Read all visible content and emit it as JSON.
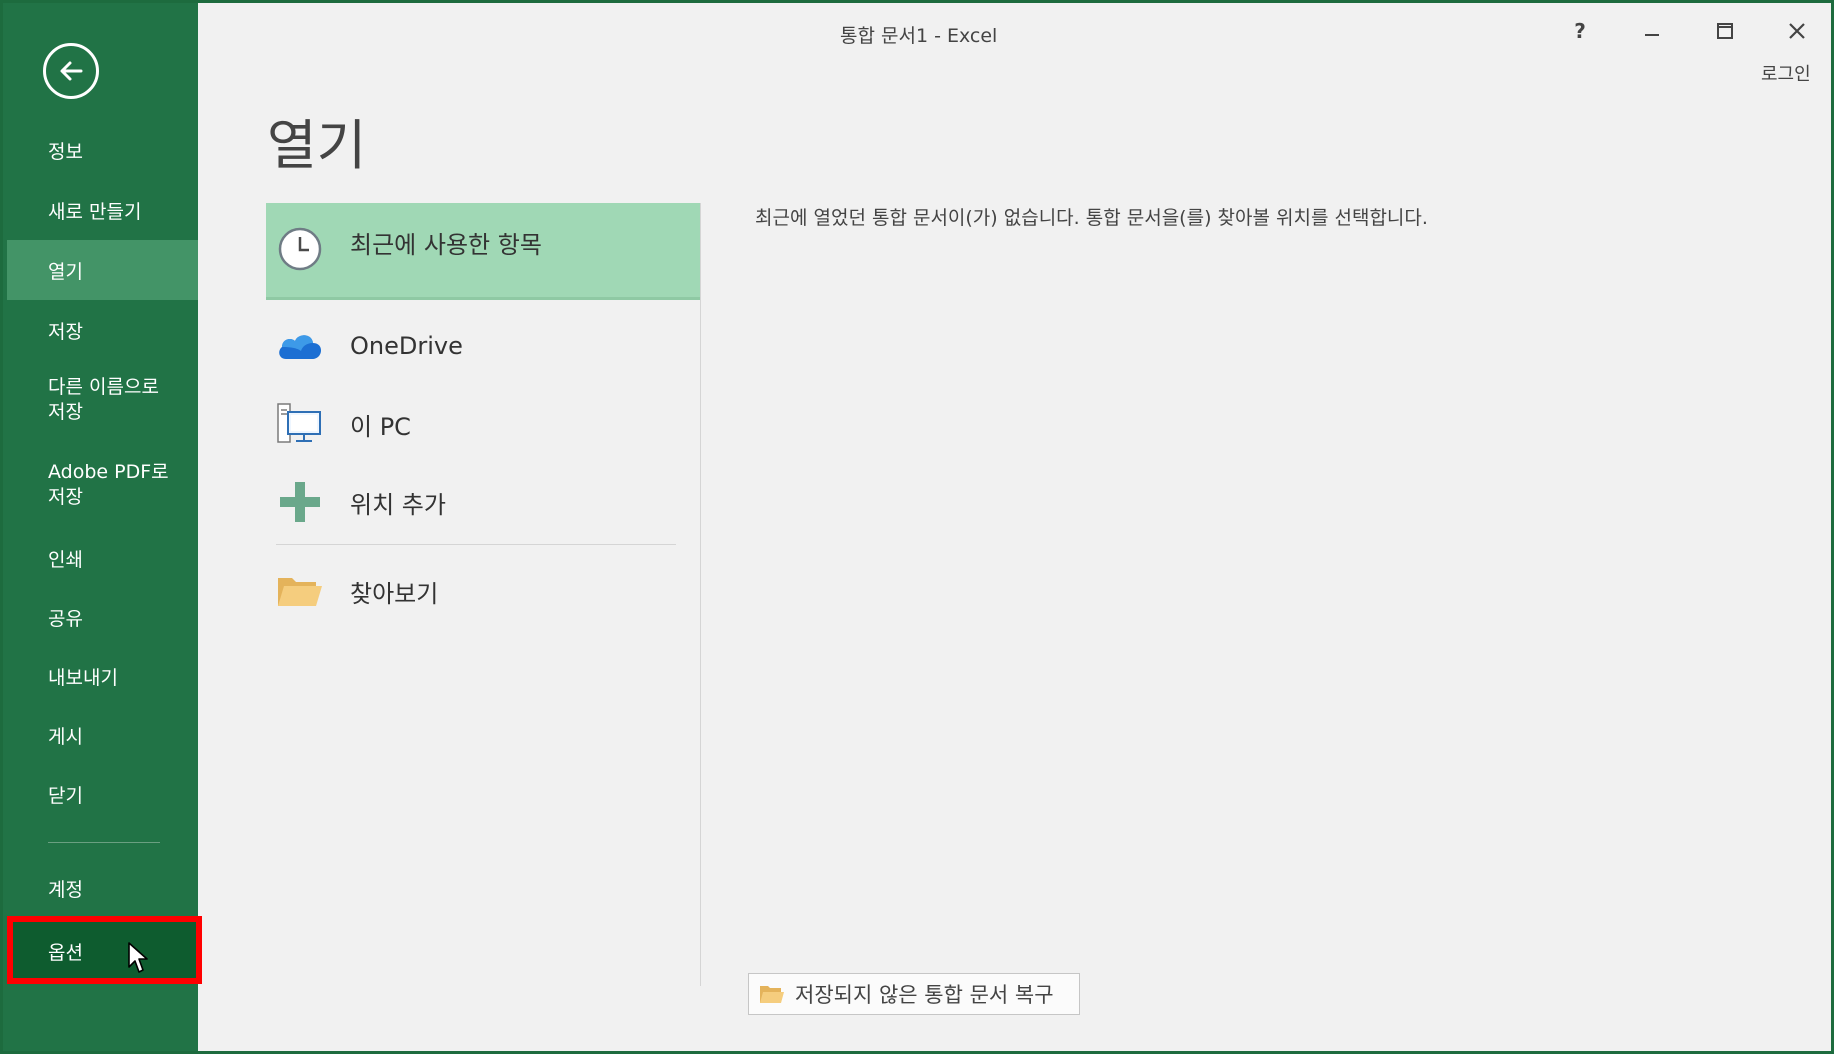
{
  "window": {
    "title": "통합 문서1 - Excel"
  },
  "titlebar": {
    "help": "?",
    "minimize": "–",
    "restore": "🗖",
    "close": "✕",
    "login": "로그인"
  },
  "sidebar": {
    "back_icon": "arrow-left-circle-icon",
    "items": [
      {
        "label": "정보"
      },
      {
        "label": "새로 만들기"
      },
      {
        "label": "열기",
        "state": "active"
      },
      {
        "label": "저장"
      },
      {
        "label": "다른 이름으로\n저장"
      },
      {
        "label": "Adobe PDF로\n저장"
      },
      {
        "label": "인쇄"
      },
      {
        "label": "공유"
      },
      {
        "label": "내보내기"
      },
      {
        "label": "게시"
      },
      {
        "label": "닫기"
      },
      {
        "label": "계정"
      },
      {
        "label": "옵션",
        "state": "hover"
      }
    ]
  },
  "page": {
    "title": "열기",
    "locations": [
      {
        "label": "최근에 사용한 항목",
        "icon": "clock-icon",
        "selected": true
      },
      {
        "label": "OneDrive",
        "icon": "cloud-icon"
      },
      {
        "label": "이 PC",
        "icon": "computer-icon"
      },
      {
        "label": "위치 추가",
        "icon": "plus-icon"
      },
      {
        "label": "찾아보기",
        "icon": "folder-icon"
      }
    ],
    "empty_message": "최근에 열었던 통합 문서이(가) 없습니다. 통합 문서을(를) 찾아볼 위치를 선택합니다.",
    "recover_button": {
      "label": "저장되지 않은 통합 문서 복구",
      "icon": "folder-icon"
    }
  },
  "colors": {
    "sidebar": "#217346",
    "sidebar_active": "#439467",
    "sidebar_hover": "#0e5c2f",
    "selected_location": "#a0d8b5",
    "highlight": "#ff0000"
  }
}
